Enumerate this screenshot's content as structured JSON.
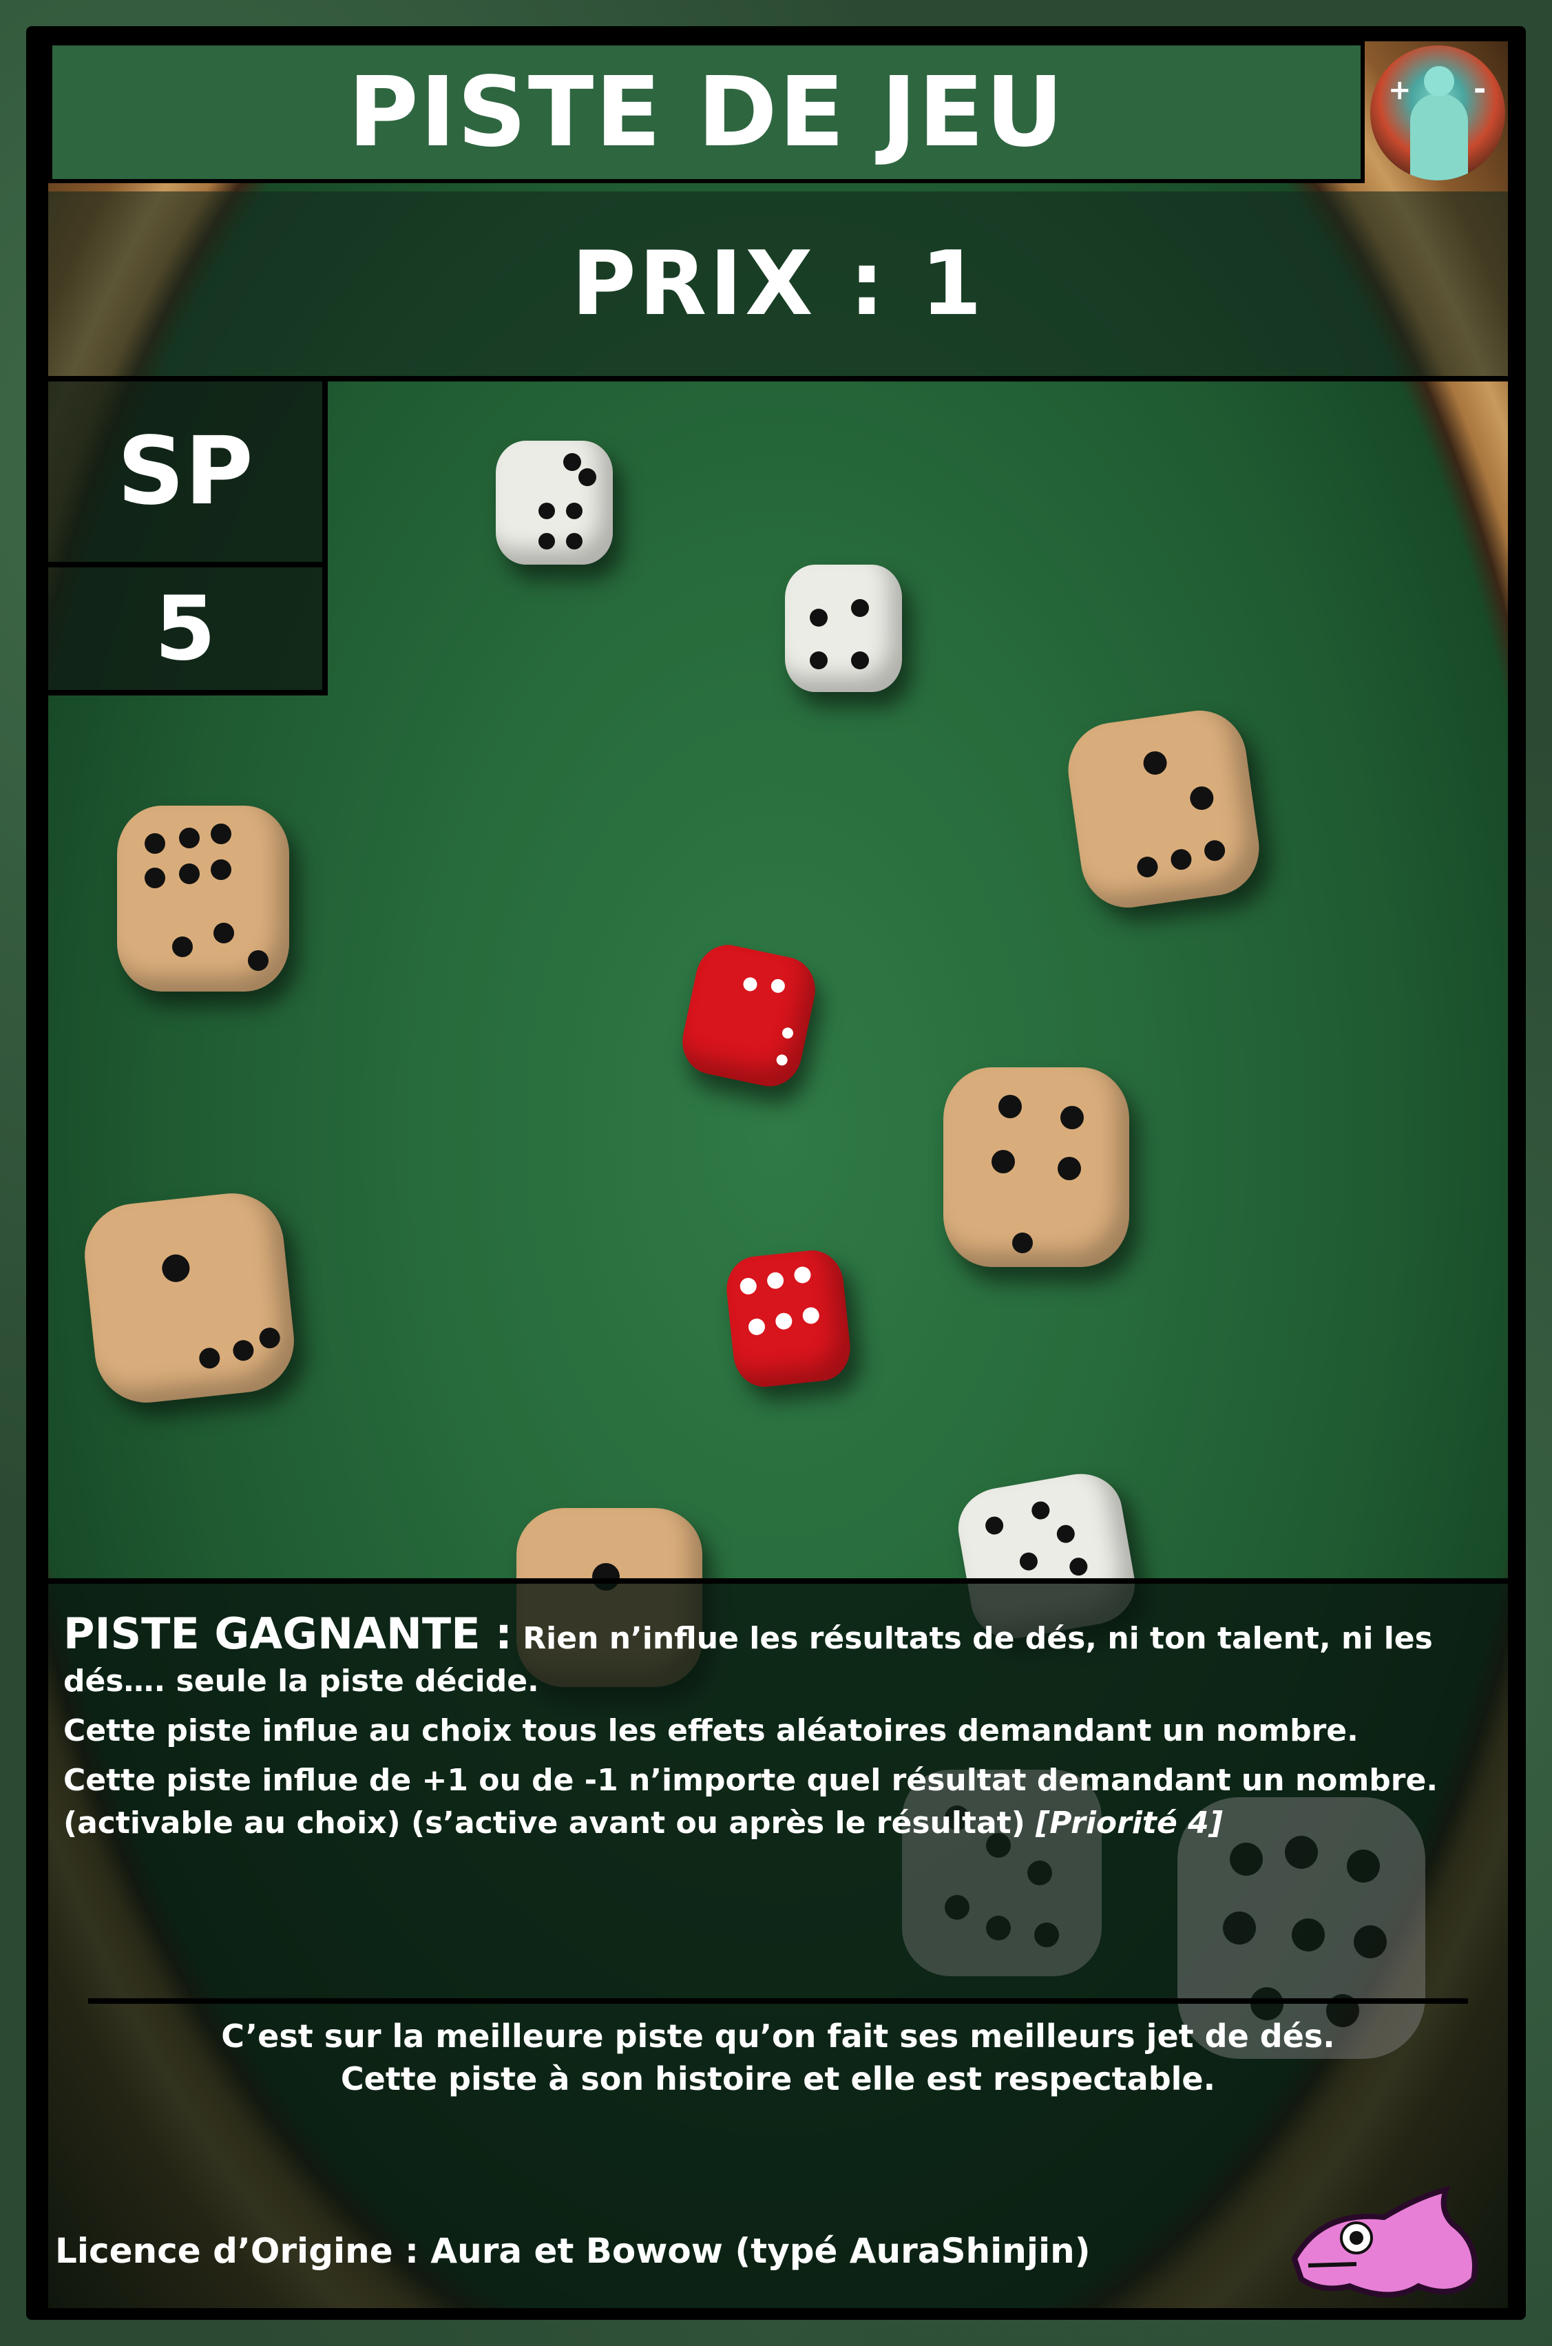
{
  "card": {
    "title": "PISTE DE JEU",
    "price": "PRIX : 1",
    "type": "SP",
    "level": "5",
    "ability_name": "PISTE GAGNANTE :",
    "ability_line1": "Rien n’influe les résultats de dés, ni ton talent, ni les dés…. seule la piste décide.",
    "ability_line2": "Cette piste influe au choix tous les effets aléatoires demandant un nombre.",
    "ability_line3": "Cette piste influe de +1 ou de -1 n’importe quel résultat demandant un nombre. (activable au choix) (s’active avant ou après le résultat)",
    "priority": "[Priorité 4]",
    "flavor_line1": "C’est sur la meilleure piste qu’on fait ses meilleurs jet de dés.",
    "flavor_line2": "Cette piste à son histoire et elle est respectable.",
    "license": "Licence d’Origine : Aura et Bowow (typé AuraShinjin)",
    "logo_plus": "+",
    "logo_minus": "-"
  },
  "colors": {
    "title_bar": "#2e6640",
    "felt": "#276a3b",
    "wood_rim": "#c99a5d",
    "red_die": "#d8141c",
    "white_die": "#ecece6",
    "wood_die": "#d9ad7b"
  },
  "icons": {
    "logo": "aura-figure-logo-icon",
    "mascot": "pink-dolphin-icon"
  }
}
